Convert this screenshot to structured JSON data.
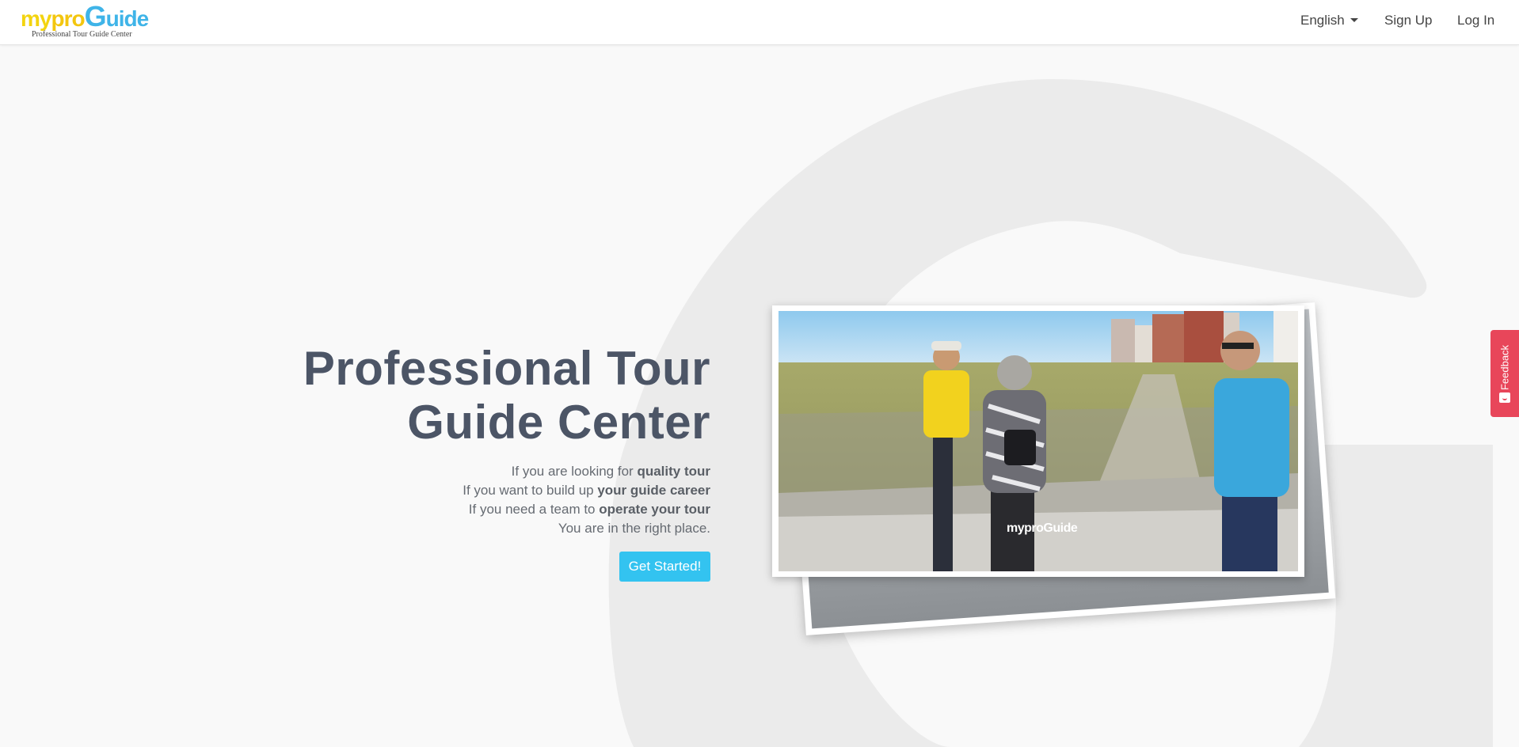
{
  "brand": {
    "logo_my": "my",
    "logo_pro": "pro",
    "logo_g": "G",
    "logo_uide": "uide",
    "tagline": "Professional Tour Guide Center",
    "accent": "#33c3f0",
    "logo_yellow": "#f3d40f",
    "logo_blue": "#3fb4e8"
  },
  "nav": {
    "language": "English",
    "signup": "Sign Up",
    "login": "Log In"
  },
  "hero": {
    "title_line1": "Professional Tour",
    "title_line2": "Guide Center",
    "lines": [
      {
        "pre": "If you are looking for ",
        "bold": "quality tour"
      },
      {
        "pre": "If you want to build up ",
        "bold": "your guide career"
      },
      {
        "pre": "If you need a team to ",
        "bold": "operate your tour"
      },
      {
        "pre": "You are in the right place.",
        "bold": ""
      }
    ],
    "cta": "Get Started!",
    "title_color": "#4c5566"
  },
  "photo": {
    "watermark_pre": "mypro",
    "watermark_g": "G",
    "watermark_post": "uide"
  },
  "feedback": {
    "label": "Feedback",
    "color": "#e8465a"
  }
}
